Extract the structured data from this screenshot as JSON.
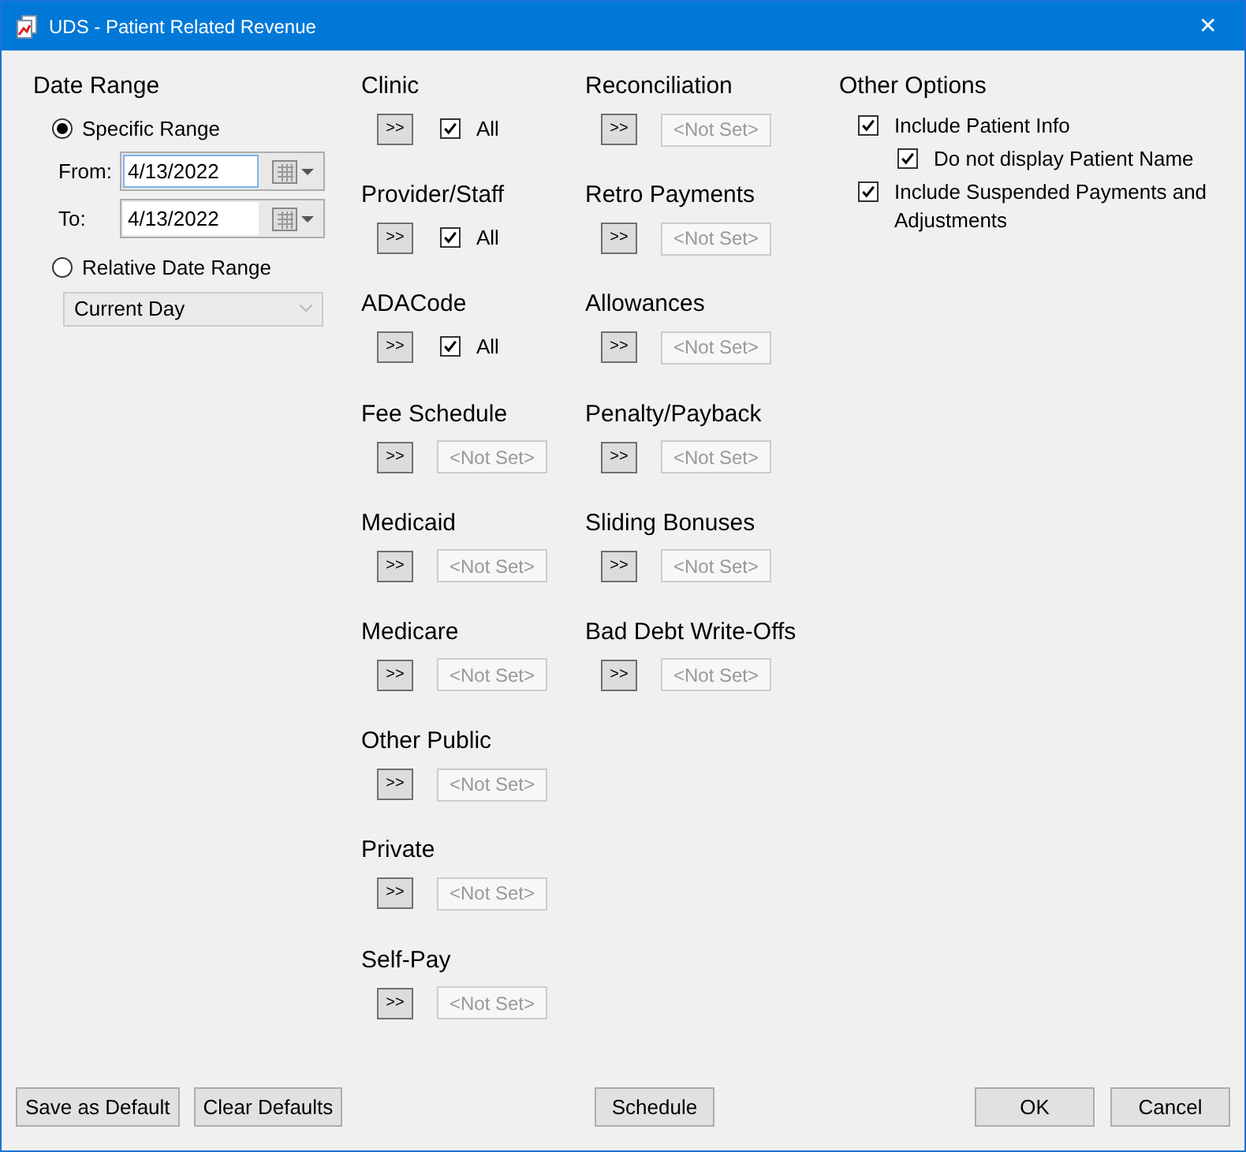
{
  "window": {
    "title": "UDS - Patient Related Revenue",
    "close": "✕"
  },
  "date_range": {
    "heading": "Date Range",
    "modes": [
      {
        "label": "Specific Range",
        "selected": true
      },
      {
        "label": "Relative Date Range",
        "selected": false
      }
    ],
    "from": {
      "label": "From:",
      "value": "4/13/2022",
      "focused": true
    },
    "to": {
      "label": "To:",
      "value": "4/13/2022",
      "focused": false
    },
    "relative": {
      "value": "Current Day",
      "disabled": true
    }
  },
  "filter_columns": [
    [
      {
        "label": "Clinic",
        "button": ">>",
        "kind": "all",
        "checked": true,
        "text": "All"
      },
      {
        "label": "Provider/Staff",
        "button": ">>",
        "kind": "all",
        "checked": true,
        "text": "All"
      },
      {
        "label": "ADACode",
        "button": ">>",
        "kind": "all",
        "checked": true,
        "text": "All"
      },
      {
        "label": "Fee Schedule",
        "button": ">>",
        "kind": "value",
        "text": "<Not Set>"
      },
      {
        "label": "Medicaid",
        "button": ">>",
        "kind": "value",
        "text": "<Not Set>"
      },
      {
        "label": "Medicare",
        "button": ">>",
        "kind": "value",
        "text": "<Not Set>"
      },
      {
        "label": "Other Public",
        "button": ">>",
        "kind": "value",
        "text": "<Not Set>"
      },
      {
        "label": "Private",
        "button": ">>",
        "kind": "value",
        "text": "<Not Set>"
      },
      {
        "label": "Self-Pay",
        "button": ">>",
        "kind": "value",
        "text": "<Not Set>"
      }
    ],
    [
      {
        "label": "Reconciliation",
        "button": ">>",
        "kind": "value",
        "text": "<Not Set>"
      },
      {
        "label": "Retro Payments",
        "button": ">>",
        "kind": "value",
        "text": "<Not Set>"
      },
      {
        "label": "Allowances",
        "button": ">>",
        "kind": "value",
        "text": "<Not Set>"
      },
      {
        "label": "Penalty/Payback",
        "button": ">>",
        "kind": "value",
        "text": "<Not Set>"
      },
      {
        "label": "Sliding Bonuses",
        "button": ">>",
        "kind": "value",
        "text": "<Not Set>"
      },
      {
        "label": "Bad Debt Write-Offs",
        "button": ">>",
        "kind": "value",
        "text": "<Not Set>"
      }
    ]
  ],
  "other_options": {
    "heading": "Other Options",
    "items": [
      {
        "label": "Include Patient Info",
        "checked": true,
        "children": [
          {
            "label": "Do not display Patient Name",
            "checked": true
          }
        ]
      },
      {
        "label": "Include Suspended Payments and Adjustments",
        "checked": true
      }
    ]
  },
  "footer": {
    "left": [
      "Save as Default",
      "Clear Defaults"
    ],
    "center": [
      "Schedule"
    ],
    "right": [
      "OK",
      "Cancel"
    ]
  }
}
